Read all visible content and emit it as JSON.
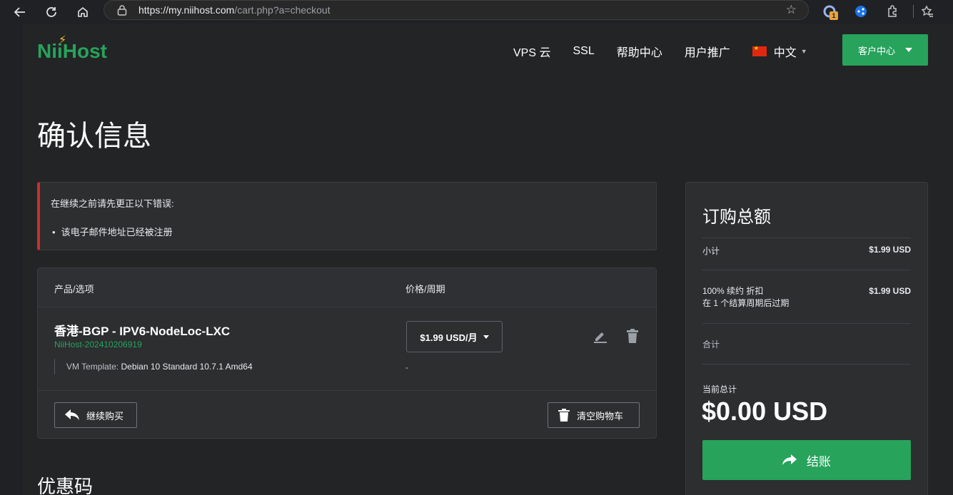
{
  "browser": {
    "url_host": "https://my.niihost.com",
    "url_path": "/cart.php?a=checkout",
    "extension_badge": "1"
  },
  "site": {
    "logo_text": "NiiHost",
    "nav": [
      "VPS 云",
      "SSL",
      "帮助中心",
      "用户推广"
    ],
    "language": "中文",
    "client_area_label": "客户中心"
  },
  "page": {
    "title": "确认信息",
    "promo_title": "优惠码"
  },
  "alert": {
    "heading": "在继续之前请先更正以下错误:",
    "errors": [
      "该电子邮件地址已经被注册"
    ]
  },
  "cart": {
    "col_product": "产品/选项",
    "col_price": "价格/周期",
    "item": {
      "name": "香港-BGP - IPV6-NodeLoc-LXC",
      "id": "NiiHost-202410206919",
      "option_label": "VM Template:",
      "option_value": "Debian 10 Standard 10.7.1 Amd64",
      "price": "$1.99 USD/月",
      "option_price": "-"
    },
    "continue_label": "继续购买",
    "empty_label": "清空购物车"
  },
  "summary": {
    "title": "订购总额",
    "subtotal_label": "小计",
    "subtotal_value": "$1.99 USD",
    "discount_line1": "100% 续约 折扣",
    "discount_line2": "在 1 个结算周期后过期",
    "discount_value": "$1.99 USD",
    "total_label": "合计",
    "current_total_label": "当前总计",
    "current_total_value": "$0.00 USD",
    "checkout_label": "结账"
  },
  "colors": {
    "accent": "#27a35c",
    "error": "#c9302c",
    "background": "#232425",
    "panel": "#2c2e30"
  }
}
